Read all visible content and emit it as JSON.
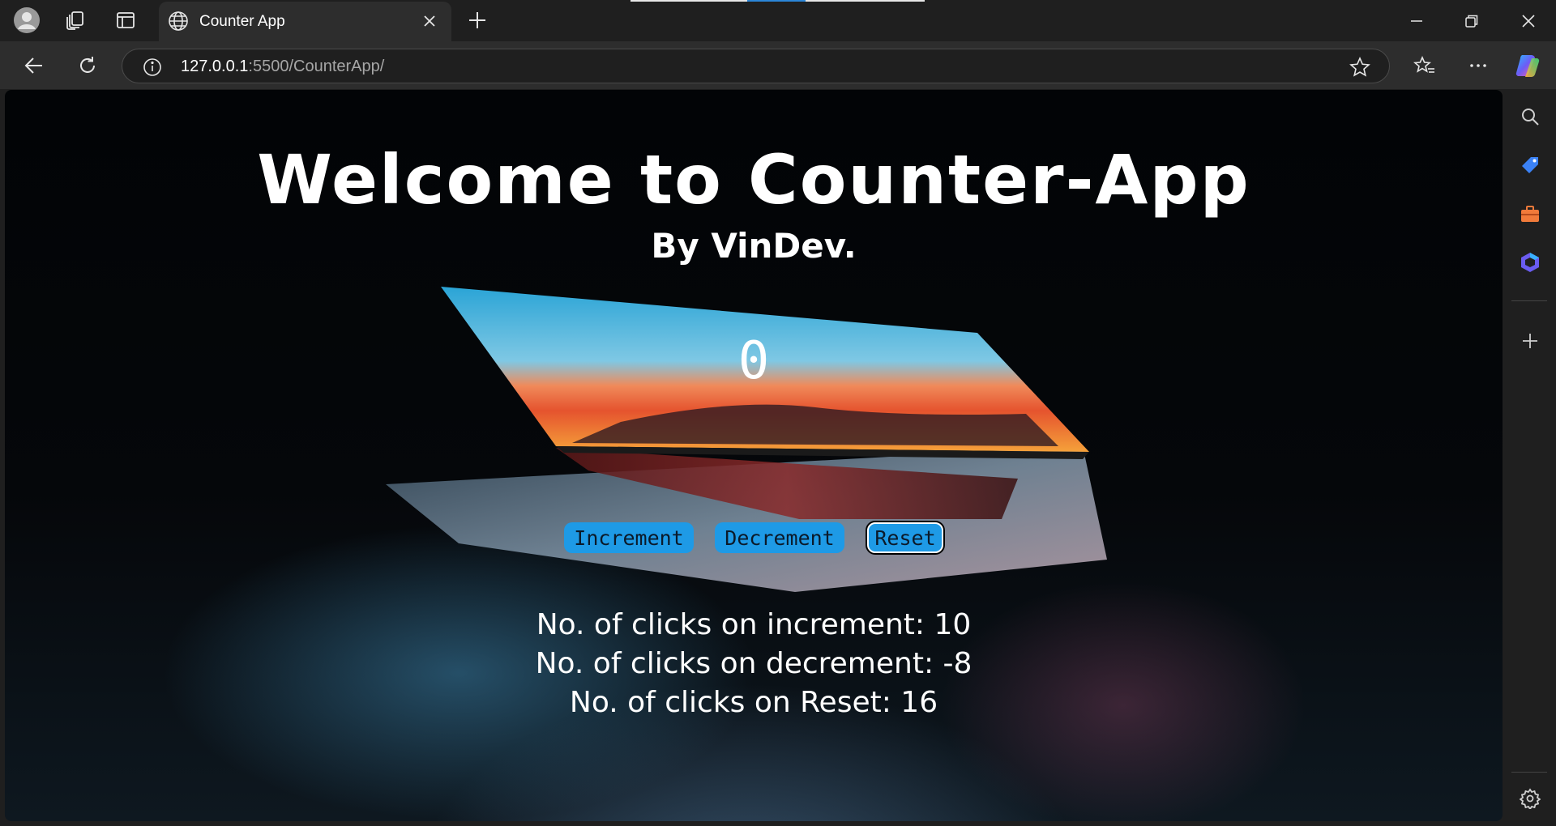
{
  "browser": {
    "tab_title": "Counter App",
    "url_host": "127.0.0.1",
    "url_rest": ":5500/CounterApp/",
    "icons": {
      "profile": "profile-icon",
      "collections": "collections-icon",
      "tab_actions": "tab-actions-icon",
      "tab_favicon": "globe-icon",
      "close_tab": "close-icon",
      "new_tab": "plus-icon",
      "minimize": "minimize-icon",
      "restore": "restore-icon",
      "close_window": "close-icon",
      "back": "back-arrow-icon",
      "refresh": "refresh-icon",
      "site_info": "info-icon",
      "favorite": "star-icon",
      "favorites": "favorites-icon",
      "more": "more-icon",
      "copilot": "copilot-icon"
    },
    "sidebar": [
      "search-icon",
      "tag-icon",
      "toolbox-icon",
      "office-icon",
      "plus-icon",
      "gear-icon"
    ]
  },
  "page": {
    "heading": "Welcome to Counter-App",
    "subheading": "By VinDev.",
    "counter_value": "0",
    "buttons": {
      "increment": "Increment",
      "decrement": "Decrement",
      "reset": "Reset"
    },
    "stats": {
      "increment_line": "No. of clicks on increment: 10",
      "decrement_line": "No. of clicks on decrement: -8",
      "reset_line": "No. of clicks on Reset: 16"
    }
  },
  "colors": {
    "button_blue": "#1e9ae6",
    "browser_dark": "#1f1f1f",
    "toolbar": "#2d2d2d"
  }
}
